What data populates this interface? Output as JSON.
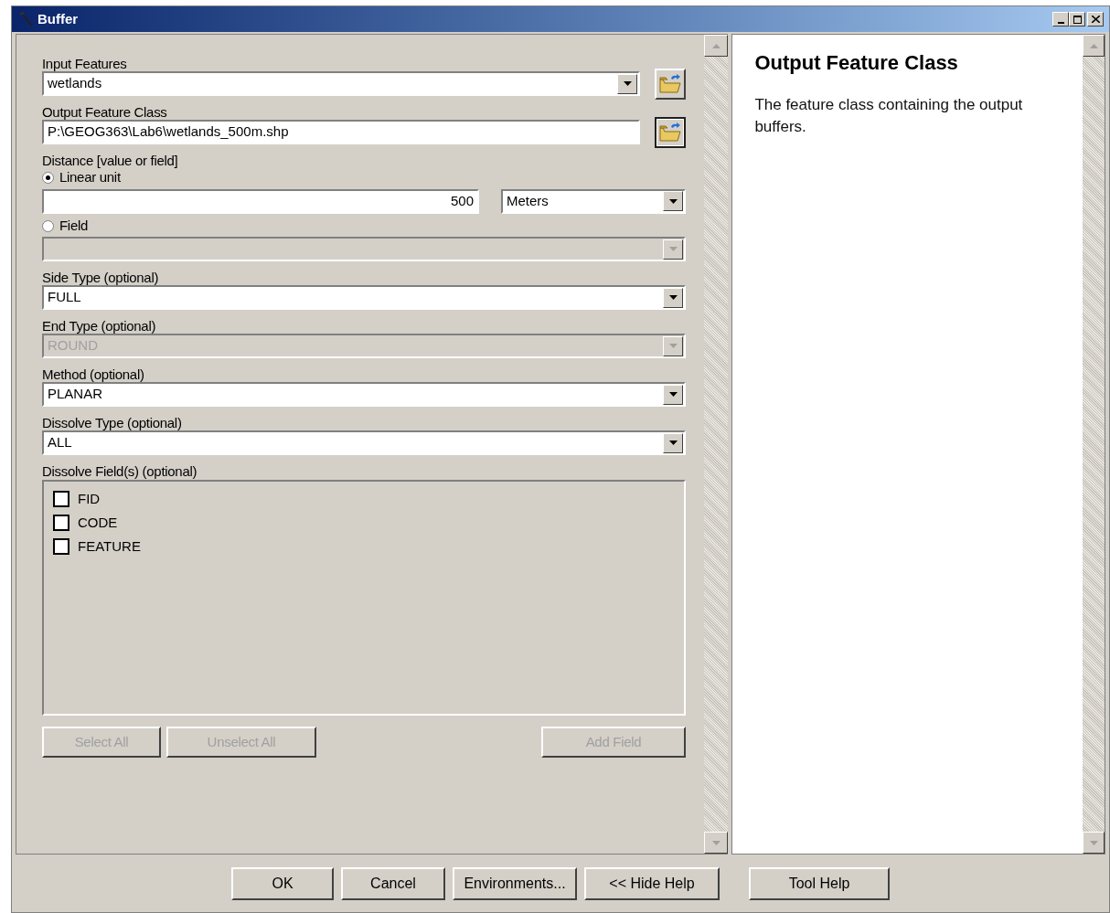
{
  "window": {
    "title": "Buffer"
  },
  "parameters": [
    {
      "kind": "dropdown",
      "label": "Input Features",
      "value": "wetlands",
      "disabled": false,
      "browse": true
    },
    {
      "kind": "text",
      "label": "Output Feature Class",
      "value": "P:\\GEOG363\\Lab6\\wetlands_500m.shp",
      "browse": true
    },
    {
      "kind": "distance",
      "label": "Distance [value or field]",
      "options": [
        {
          "label": "Linear unit",
          "selected": true
        },
        {
          "label": "Field",
          "selected": false
        }
      ],
      "value": "500",
      "unit": "Meters"
    },
    {
      "kind": "dropdown",
      "label": "Side Type (optional)",
      "value": "FULL",
      "disabled": false
    },
    {
      "kind": "dropdown",
      "label": "End Type (optional)",
      "value": "ROUND",
      "disabled": true
    },
    {
      "kind": "dropdown",
      "label": "Method (optional)",
      "value": "PLANAR",
      "disabled": false
    },
    {
      "kind": "dropdown",
      "label": "Dissolve Type (optional)",
      "value": "ALL",
      "disabled": false
    },
    {
      "kind": "checklist",
      "label": "Dissolve Field(s) (optional)",
      "items": [
        {
          "label": "FID",
          "checked": false
        },
        {
          "label": "CODE",
          "checked": false
        },
        {
          "label": "FEATURE",
          "checked": false
        }
      ],
      "buttons": [
        {
          "label": "Select All",
          "disabled": true
        },
        {
          "label": "Unselect All",
          "disabled": true
        },
        {
          "label": "Add Field",
          "disabled": true
        }
      ]
    }
  ],
  "help": {
    "title": "Output Feature Class",
    "text": "The feature class containing the output buffers."
  },
  "buttons": [
    "OK",
    "Cancel",
    "Environments...",
    "<< Hide Help",
    "Tool Help"
  ]
}
